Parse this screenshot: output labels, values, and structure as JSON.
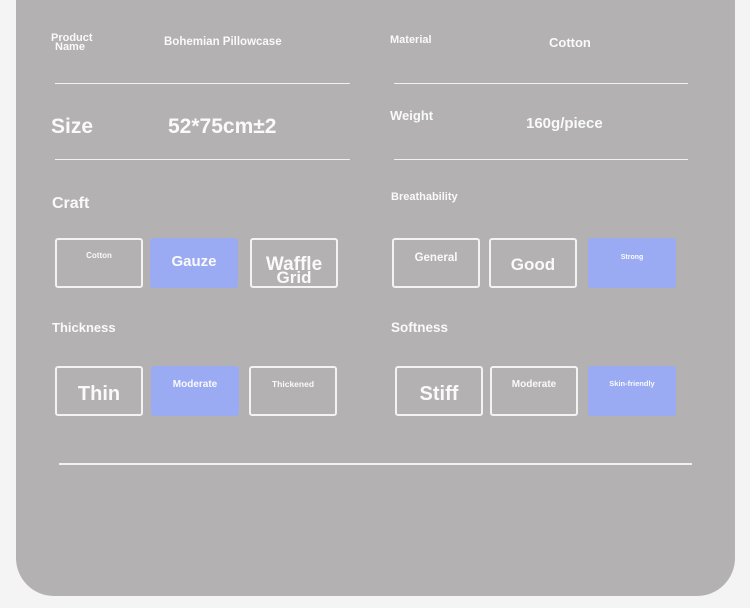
{
  "specs": {
    "product_name_label_line1": "Product",
    "product_name_label_line2": "Name",
    "product_name_value": "Bohemian Pillowcase",
    "material_label": "Material",
    "material_value": "Cotton",
    "size_label": "Size",
    "size_value": "52*75cm±2",
    "weight_label": "Weight",
    "weight_value": "160g/piece"
  },
  "craft": {
    "label": "Craft",
    "options": [
      "Cotton",
      "Gauze",
      "Waffle",
      "Grid"
    ],
    "selected": "Gauze"
  },
  "breathability": {
    "label": "Breathability",
    "options": [
      "General",
      "Good",
      "Strong"
    ],
    "selected": "Strong"
  },
  "thickness": {
    "label": "Thickness",
    "options": [
      "Thin",
      "Moderate",
      "Thickened"
    ],
    "selected": "Moderate"
  },
  "softness": {
    "label": "Softness",
    "options": [
      "Stiff",
      "Moderate",
      "Skin-friendly"
    ],
    "selected": "Skin-friendly"
  },
  "colors": {
    "card_background": "#b3b1b2",
    "page_background": "#f4f4f4",
    "selected_option": "#9aabf3",
    "text": "#fafafa"
  }
}
